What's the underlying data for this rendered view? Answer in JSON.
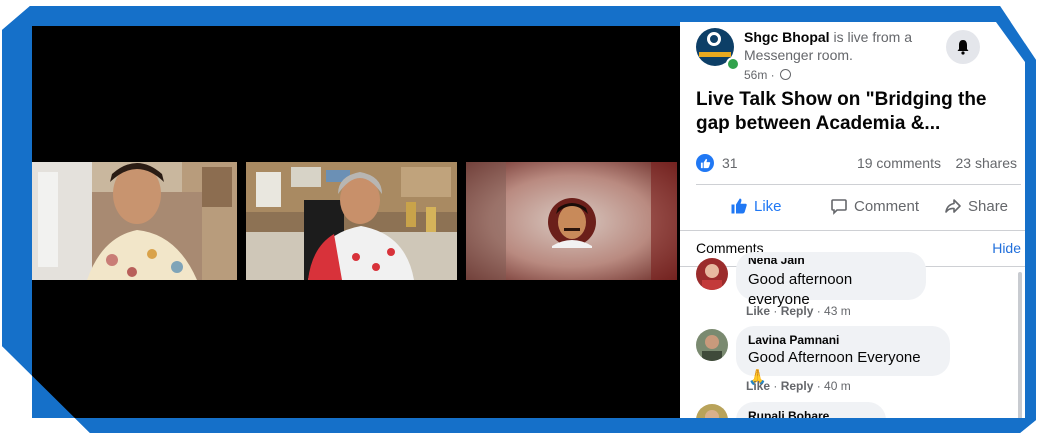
{
  "post": {
    "page_name": "Shgc Bhopal",
    "live_status": " is live from a Messenger room.",
    "time_ago": "56m · ",
    "title": "Live Talk Show on \"Bridging the gap between Academia &..."
  },
  "stats": {
    "likes": "31",
    "comments": "19 comments",
    "shares": "23 shares"
  },
  "actions": {
    "like": "Like",
    "comment": "Comment",
    "share": "Share"
  },
  "comments_section": {
    "heading": "Comments",
    "hide": "Hide",
    "items": [
      {
        "author": "Neha Jain",
        "text": "Good afternoon everyone",
        "like": "Like",
        "reply": "Reply",
        "time": " · 43 m"
      },
      {
        "author": "Lavina Pamnani",
        "text": "Good Afternoon Everyone 🙏",
        "like": "Like",
        "reply": "Reply",
        "time": " · 40 m"
      },
      {
        "author": "Rupali Bohare",
        "text": "",
        "like": "",
        "reply": "",
        "time": ""
      }
    ]
  },
  "icons": [
    "bell-icon",
    "globe-icon",
    "thumbs-up-icon",
    "comment-icon",
    "share-icon",
    "prayer-hands-emoji"
  ],
  "colors": {
    "frame_blue": "#1570c9",
    "facebook_blue": "#2078f4",
    "link_blue": "#216fdb"
  }
}
